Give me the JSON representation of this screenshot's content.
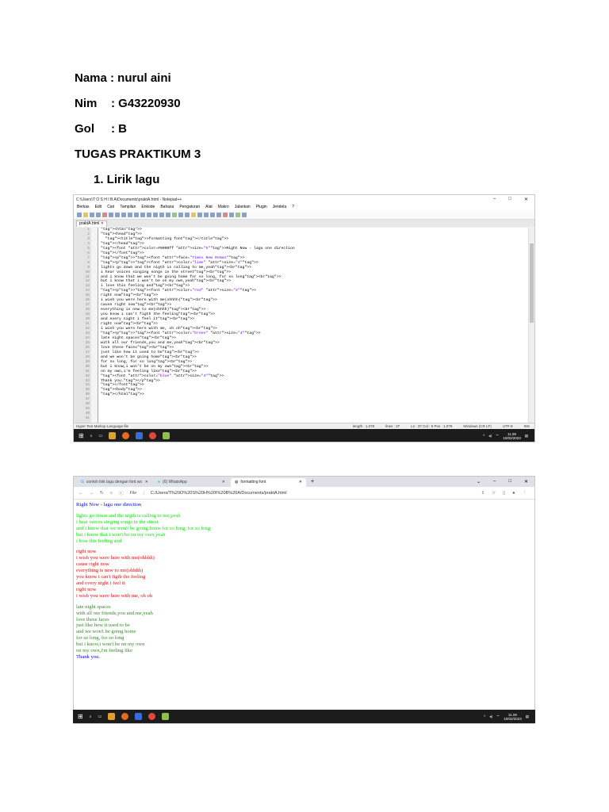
{
  "doc": {
    "nama": "Nama : nurul aini",
    "nim_label": "Nim",
    "nim_value": ": G43220930",
    "gol_label": "Gol",
    "gol_value": ": B",
    "heading": "TUGAS PRAKTIKUM 3",
    "list_item": "1.  Lirik lagu"
  },
  "notepad": {
    "title": "C:\\Users\\T O S H I B A\\Documents\\praktA.html - Notepad++",
    "menu": [
      "Berkas",
      "Edit",
      "Cari",
      "Tampilan",
      "Enkode",
      "Bahasa",
      "Pengaturan",
      "Alat",
      "Makro",
      "Jalankan",
      "Plugin",
      "Jendela",
      "?"
    ],
    "tab": "praktA.html",
    "line_numbers": [
      "1",
      "2",
      "3",
      "4",
      "5",
      "6",
      "7",
      "8",
      "9",
      "10",
      "11",
      "12",
      "13",
      "14",
      "15",
      "16",
      "17",
      "18",
      "19",
      "20",
      "21",
      "22",
      "23",
      "24",
      "25",
      "26",
      "27",
      "28",
      "29",
      "30",
      "31",
      "32",
      "33",
      "34",
      "35",
      "36",
      "37",
      "38",
      "39",
      "40",
      "41"
    ],
    "status": {
      "lang": "Hyper Text Markup Language file",
      "length": "length : 1,078",
      "lines": "lines : 37",
      "pos": "Ln : 37   Col : 8   Pos : 1,079",
      "eol": "Windows (CR LF)",
      "enc": "UTF-8",
      "ins": "INS"
    }
  },
  "taskbar": {
    "time": "11.09",
    "date": "10/02/2023"
  },
  "browser": {
    "tabs": [
      "contoh lirik lagu dengan font wo",
      "(6) WhatsApp",
      "formatting font"
    ],
    "url_prefix": "File",
    "url": "C:/Users/T%20O%20S%20H%20I%20B%20A/Documents/praktA.html"
  },
  "page_text": {
    "p1": [
      "Right Now - lagu one direction"
    ],
    "p2": [
      "lights go down and the nigth is calling to me,yeah",
      "i hear voices singing songs in the street",
      "and i know that we won't be going home for so long, for so long",
      "but i know that i won't be on my own,yeah",
      "i love this feeling and"
    ],
    "p3": [
      "right now",
      "i wish you were here with me(ohhhh)",
      "cause right now",
      "everything is new to me(ohhhh)",
      "you know i can't figth the feeling",
      "and every night i feel it",
      "right now",
      "i wish you were here with me, oh oh"
    ],
    "p4": [
      "late night spaces",
      "with all our friends,you and me,yeah",
      "love these faces",
      "just like how it used to be",
      "and we won't be going home",
      "for so long, for so long",
      "but i know,i won't be on my own",
      "on my own,i'm feeling like"
    ],
    "p5": [
      "Thank you."
    ]
  },
  "colors": {
    "p1": "#0000ff",
    "p2": "#00ee00",
    "p3": "#ff0000",
    "p4": "#2e8b22",
    "p5": "#0000ff"
  }
}
